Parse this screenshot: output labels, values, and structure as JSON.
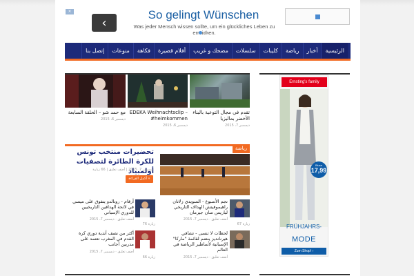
{
  "header_ad": {
    "title": "So gelingt Wünschen",
    "subtitle": "Was jeder Mensch wissen sollte, um ein glückliches Leben zu erreichen.",
    "back_glyph": "‹",
    "ad_label": "×"
  },
  "nav": {
    "items": [
      "الرئيسية",
      "أخبار",
      "رياضة",
      "كليبات",
      "سلسلات",
      "مضحك و غريب",
      "أفلام قصيرة",
      "فكاهة",
      "منوعات",
      "إتصل بنا"
    ]
  },
  "top_posts": [
    {
      "title": "تقدم في مجال التوعية بالبناء الأخضر بماليزيا",
      "date": "ديسمبر 7، 2015"
    },
    {
      "title": "EDEKA Weihnachtsclip – #heimkommen",
      "date": "ديسمبر 6، 2015"
    },
    {
      "title": "مع حمد شو – الحلقة السابعة",
      "date": "ديسمبر 6، 2015"
    }
  ],
  "featured": {
    "category": "رياضة",
    "title": "تحضيرات منتخب تونس للكرة الطائرة لتصفيات أولمبياد",
    "date": "ديسمبر 7، 2015",
    "comments": "أضف تعليق",
    "views": "66 زيارة",
    "read_more": "أكمل القراءة »"
  },
  "small_posts": [
    {
      "title": "نجم الأسبوع - السويدي زلاتان راهيموفيتش الهداف التاريخي لباريس سان جيرمان",
      "date": "ديسمبر 7، 2015",
      "comments": "أضف تعليق",
      "views": "67 زيارة"
    },
    {
      "title": "أرقام - رونالدو يتفوق على ميسي في لائحة الهدافين التاريخيين للدوري الإسباني",
      "date": "ديسمبر 7، 2015",
      "comments": "أضف تعليق",
      "views": "76 زيارة"
    },
    {
      "title": "لحظات لا تنسى - تشافي هيرنانديز ينضم لقائمة \"ماركا\" الإسبانية لأساطير الرياضة في العالم",
      "date": "ديسمبر 7، 2015",
      "comments": "أضف تعليق",
      "views": "64 زيارة"
    },
    {
      "title": "أكثر من نصف أندية دوري كرة القدم في المغرب تعتمد على مدربين أجانب",
      "date": "ديسمبر 7، 2015",
      "comments": "أضف تعليق",
      "views": "66 زيارة"
    }
  ],
  "sidebar_ad": {
    "brand": "Ernsting's family",
    "price_label": "Bluse",
    "price": "17,99",
    "line1": "FRÜHJAHRS-",
    "line2": "MODE",
    "shop": "Zum Shop! ›"
  },
  "colors": {
    "nav": "#1d2a7a",
    "accent": "#f26a22",
    "link": "#1b5fa3"
  }
}
